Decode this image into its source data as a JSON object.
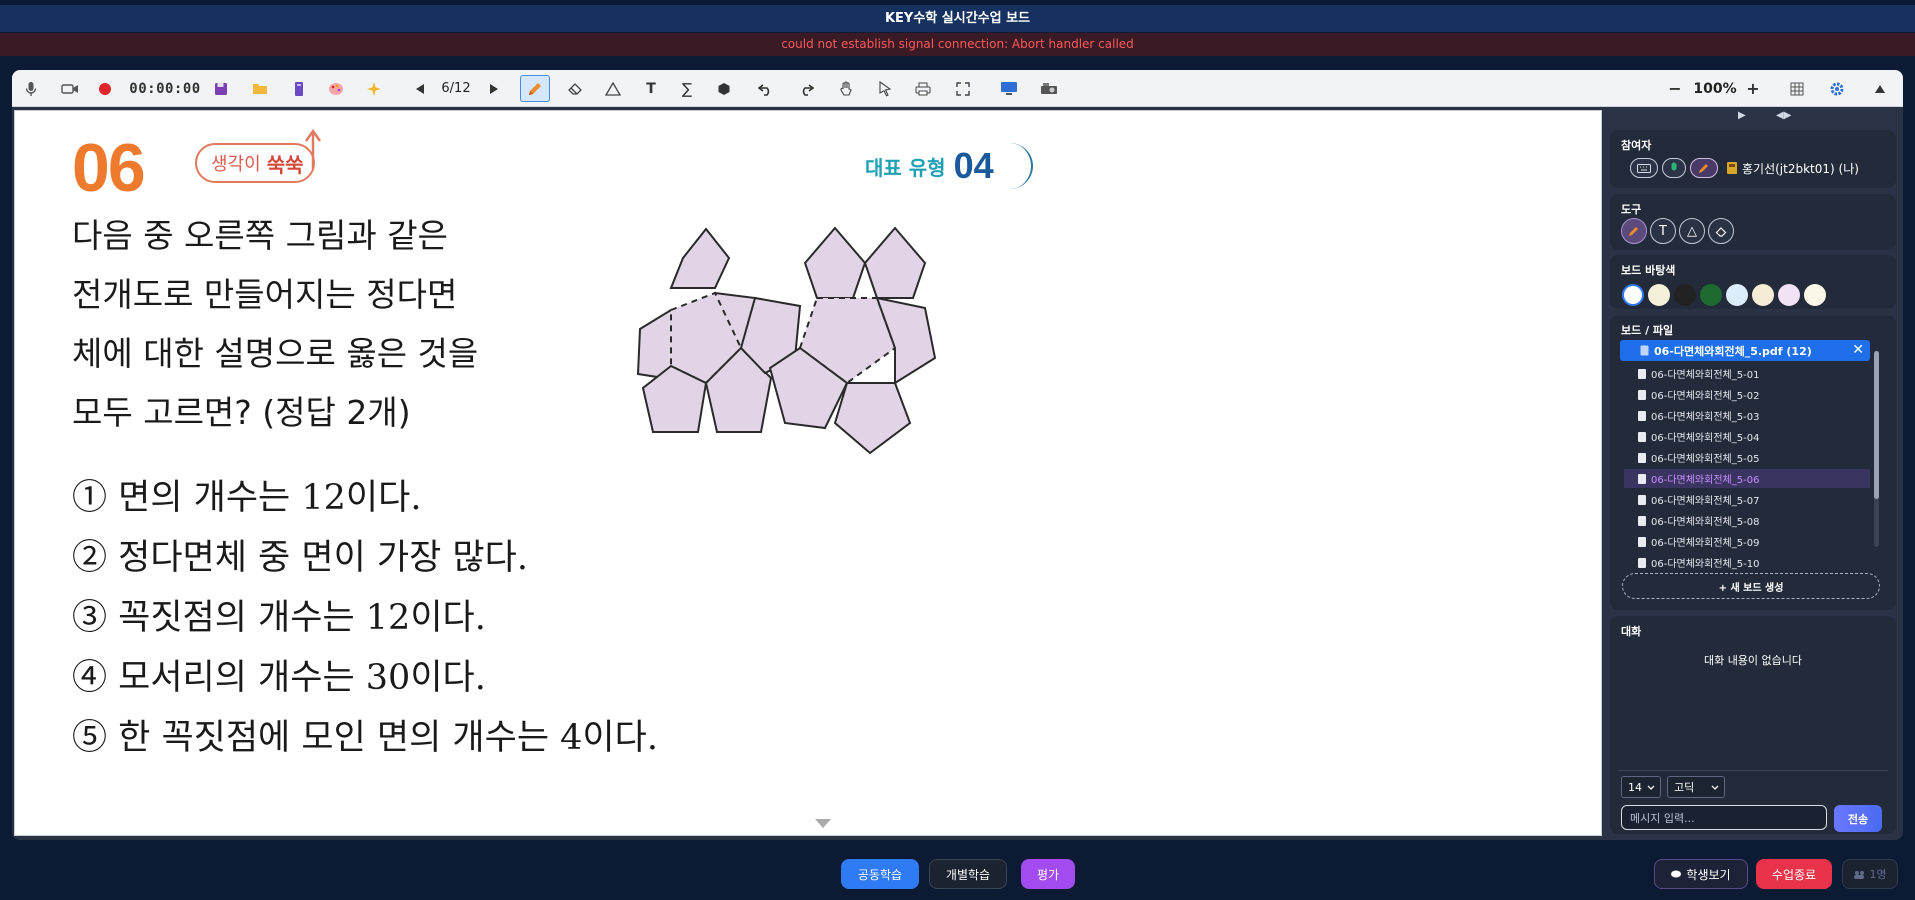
{
  "window": {
    "title": "KEY수학 실시간수업 보드",
    "error": "could not establish signal connection: Abort handler called"
  },
  "toolbar": {
    "timer": "00:00:00",
    "page": "6/12",
    "zoom": "100%",
    "zoom_minus": "−",
    "zoom_plus": "+",
    "icons": [
      "mic-icon",
      "camera-icon",
      "record-icon",
      "save-icon",
      "folder-icon",
      "book-icon",
      "palette-icon",
      "sparkle-icon",
      "prev-page-icon",
      "next-page-icon",
      "pen-icon",
      "eraser-icon",
      "shape-icon",
      "text-icon",
      "formula-icon",
      "fill-icon",
      "undo-icon",
      "redo-icon",
      "hand-icon",
      "pointer-icon",
      "print-icon",
      "fullscreen-icon",
      "monitor-icon",
      "projector-icon",
      "grid-icon",
      "settings-icon",
      "collapse-icon"
    ]
  },
  "board": {
    "problem_number": "06",
    "badge_left": [
      "생각이",
      "쑥쑥"
    ],
    "badge_right": [
      "대표 유형",
      "04"
    ],
    "question_lines": [
      "다음 중 오른쪽 그림과 같은",
      "전개도로 만들어지는 정다면",
      "체에 대한 설명으로 옳은 것을",
      "모두 고르면? (정답 2개)"
    ],
    "choices": [
      "① 면의 개수는 12이다.",
      "② 정다면체 중 면이 가장 많다.",
      "③ 꼭짓점의 개수는 12이다.",
      "④ 모서리의 개수는 30이다.",
      "⑤ 한 꼭짓점에 모인 면의 개수는 4이다."
    ],
    "net_fill": "#e0d4e6"
  },
  "sidebar": {
    "arrows": [
      "▶",
      "◀▶"
    ],
    "participants": {
      "title": "참여자",
      "user": "홍기선(jt2bkt01) (나)"
    },
    "tools": {
      "title": "도구",
      "items": [
        "pen",
        "T",
        "△",
        "eraser"
      ]
    },
    "bg": {
      "title": "보드 바탕색",
      "colors": [
        "#ffffff",
        "#f5f0d8",
        "#222222",
        "#1e6a30",
        "#dcecf8",
        "#f6ecd6",
        "#f1e2f6",
        "#faf6e8"
      ]
    },
    "files": {
      "title": "보드 / 파일",
      "pdf": "06-다면체와회전체_5.pdf (12)",
      "close": "✕",
      "items": [
        "06-다면체와회전체_5-01",
        "06-다면체와회전체_5-02",
        "06-다면체와회전체_5-03",
        "06-다면체와회전체_5-04",
        "06-다면체와회전체_5-05",
        "06-다면체와회전체_5-06",
        "06-다면체와회전체_5-07",
        "06-다면체와회전체_5-08",
        "06-다면체와회전체_5-09",
        "06-다면체와회전체_5-10"
      ],
      "selected_index": 5,
      "new_board": "+ 새 보드 생성"
    },
    "chat": {
      "title": "대화",
      "empty": "대화 내용이 없습니다",
      "font_size": "14",
      "font_family": "고딕",
      "placeholder": "메시지 입력...",
      "send": "전송"
    }
  },
  "bottom": {
    "mode_common": "공동학습",
    "mode_individual": "개별학습",
    "mode_eval": "평가",
    "view_students": "학생보기",
    "end_class": "수업종료",
    "count": "1명",
    "colors": {
      "common": "#2f7af5",
      "eval": "#a24bf0",
      "end": "#e8334a"
    }
  }
}
